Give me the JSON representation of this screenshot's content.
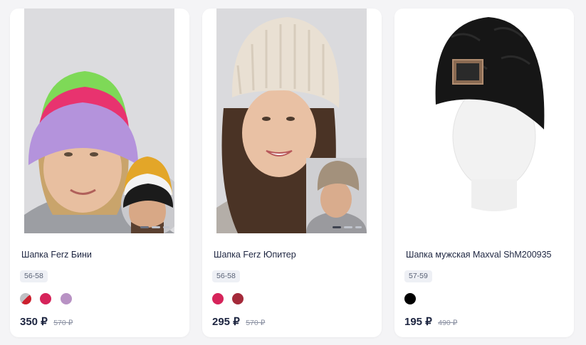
{
  "products": [
    {
      "title": "Шапка Ferz Бини",
      "size": "56-58",
      "price": "350 ₽",
      "old_price": "570 ₽",
      "swatches": [
        "#c0c0c4",
        "#d6245a",
        "#b892c4"
      ]
    },
    {
      "title": "Шапка Ferz Юпитер",
      "size": "56-58",
      "price": "295 ₽",
      "old_price": "570 ₽",
      "swatches": [
        "#d6245a",
        "#a42a3a"
      ]
    },
    {
      "title": "Шапка мужская Maxval ShM200935",
      "size": "57-59",
      "price": "195 ₽",
      "old_price": "490 ₽",
      "swatches": [
        "#000000"
      ]
    }
  ]
}
